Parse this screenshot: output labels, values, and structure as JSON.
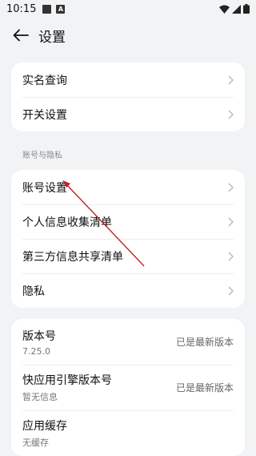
{
  "status_bar": {
    "time": "10:15",
    "notif_icon_letter": "A"
  },
  "header": {
    "title": "设置"
  },
  "card1": {
    "items": [
      {
        "label": "实名查询"
      },
      {
        "label": "开关设置"
      }
    ]
  },
  "section_privacy": {
    "title": "账号与隐私"
  },
  "card2": {
    "items": [
      {
        "label": "账号设置"
      },
      {
        "label": "个人信息收集清单"
      },
      {
        "label": "第三方信息共享清单"
      },
      {
        "label": "隐私"
      }
    ]
  },
  "card3": {
    "items": [
      {
        "label": "版本号",
        "sub": "7.25.0",
        "status": "已是最新版本"
      },
      {
        "label": "快应用引擎版本号",
        "sub": "暂无信息",
        "status": "已是最新版本"
      },
      {
        "label": "应用缓存",
        "sub": "无缓存"
      }
    ]
  },
  "colors": {
    "annotation_arrow": "#c0202a",
    "background": "#f1f3f5"
  }
}
